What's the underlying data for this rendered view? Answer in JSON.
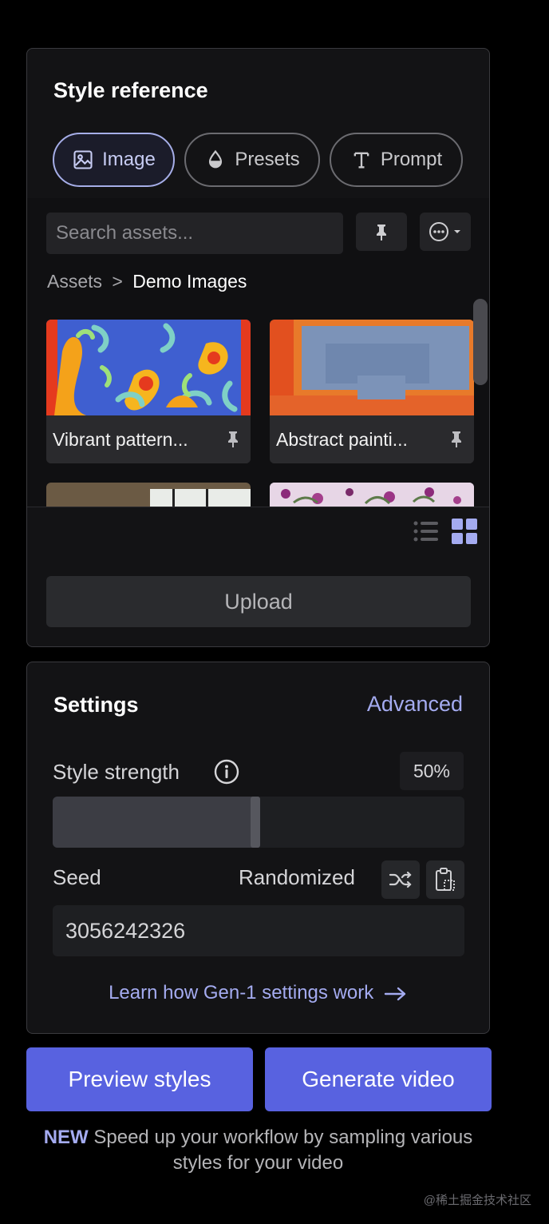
{
  "style_reference": {
    "title": "Style reference",
    "tabs": [
      {
        "label": "Image",
        "icon": "image-icon",
        "active": true
      },
      {
        "label": "Presets",
        "icon": "drop-icon",
        "active": false
      },
      {
        "label": "Prompt",
        "icon": "text-icon",
        "active": false
      }
    ],
    "search": {
      "placeholder": "Search assets..."
    },
    "breadcrumb": {
      "root": "Assets",
      "separator": ">",
      "current": "Demo Images"
    },
    "assets": [
      {
        "label": "Vibrant pattern...",
        "pin_icon": "pin-icon"
      },
      {
        "label": "Abstract painti...",
        "pin_icon": "pin-icon"
      }
    ],
    "view_modes": {
      "list_icon": "list-view-icon",
      "grid_icon": "grid-view-icon",
      "selected": "grid"
    },
    "upload_label": "Upload"
  },
  "settings": {
    "title": "Settings",
    "advanced_label": "Advanced",
    "style_strength": {
      "label": "Style strength",
      "value_text": "50%",
      "value": 0.5
    },
    "seed": {
      "label": "Seed",
      "mode_label": "Randomized",
      "value": "3056242326"
    },
    "learn_link": "Learn how Gen-1 settings work"
  },
  "actions": {
    "preview_label": "Preview styles",
    "generate_label": "Generate video"
  },
  "footer_note": {
    "badge": "NEW",
    "text": "Speed up your workflow by sampling various styles for your video"
  },
  "watermark": "@稀土掘金技术社区",
  "colors": {
    "accent": "#5862e0",
    "link": "#a4abf0",
    "panel": "#131315"
  }
}
